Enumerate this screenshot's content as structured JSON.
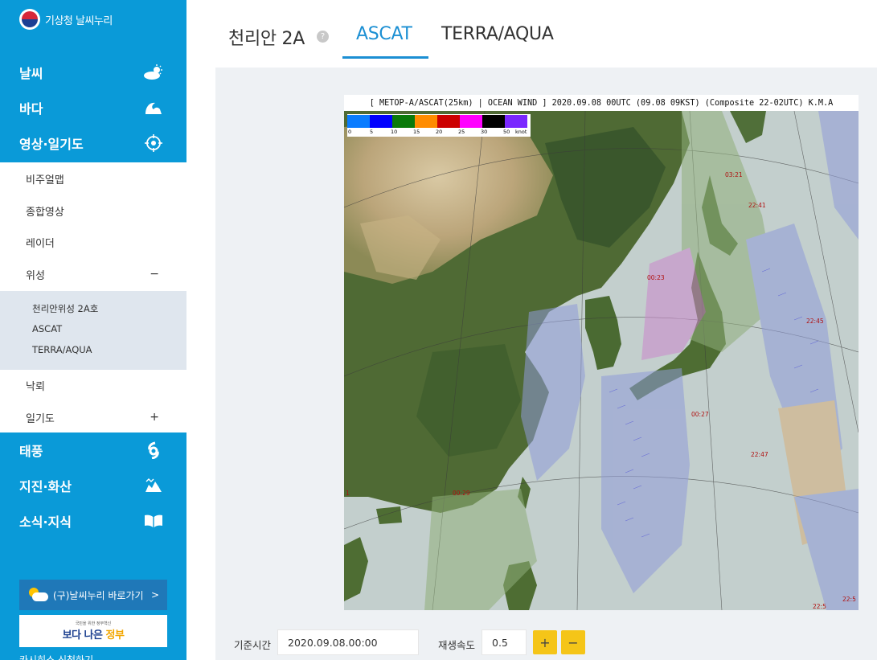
{
  "brand": {
    "title": "기상청 날씨누리"
  },
  "sidebar": {
    "main_items": [
      {
        "label": "날씨",
        "icon": "weather-icon"
      },
      {
        "label": "바다",
        "icon": "wave-icon"
      },
      {
        "label": "영상·일기도",
        "icon": "satellite-target-icon"
      },
      {
        "label": "태풍",
        "icon": "typhoon-icon"
      },
      {
        "label": "지진·화산",
        "icon": "earthquake-icon"
      },
      {
        "label": "소식·지식",
        "icon": "book-icon"
      }
    ],
    "sub_items": [
      {
        "label": "비주얼맵",
        "sign": ""
      },
      {
        "label": "종합영상",
        "sign": ""
      },
      {
        "label": "레이더",
        "sign": ""
      },
      {
        "label": "위성",
        "sign": "−"
      },
      {
        "label": "낙뢰",
        "sign": ""
      },
      {
        "label": "일기도",
        "sign": "+"
      }
    ],
    "satellite_items": [
      "천리안위성 2A호",
      "ASCAT",
      "TERRA/AQUA"
    ],
    "old_site_button": "(구)날씨누리 바로가기",
    "old_site_arrow": ">",
    "gov_banner_small": "국민을 위한 정부혁신",
    "gov_banner_text": "보다 나은 정부",
    "cut_text": "카시히소 신청하기"
  },
  "tabs": [
    {
      "label": "천리안 2A",
      "active": false
    },
    {
      "label": "ASCAT",
      "active": true
    },
    {
      "label": "TERRA/AQUA",
      "active": false
    }
  ],
  "help_icon": "?",
  "map": {
    "header": "[ METOP-A/ASCAT(25km) | OCEAN WIND ]  2020.09.08 00UTC (09.08 09KST) (Composite 22-02UTC) K.M.A",
    "legend": {
      "colors": [
        "#0a7cff",
        "#0000ff",
        "#0a7a0a",
        "#ff8c00",
        "#cc0000",
        "#ff00ff",
        "#000000",
        "#7a28ff"
      ],
      "labels": [
        "0",
        "5",
        "10",
        "15",
        "20",
        "25",
        "30",
        "50",
        "knot"
      ]
    },
    "time_labels": [
      "03:21",
      "22:41",
      "00:23",
      "22:45",
      "00:27",
      "22:47",
      "00:29",
      "22:5",
      "22:5",
      "1"
    ]
  },
  "controls": {
    "time_label": "기준시간",
    "time_value": "2020.09.08.00:00",
    "speed_label": "재생속도",
    "speed_value": "0.5",
    "plus": "+",
    "minus": "−"
  }
}
